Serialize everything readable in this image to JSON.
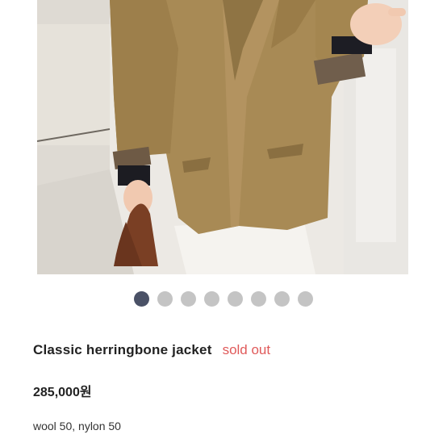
{
  "product": {
    "title": "Classic herringbone jacket",
    "status": "sold out",
    "price": "285,000원",
    "material": "wool 50, nylon 50"
  },
  "carousel": {
    "total": 8,
    "active_index": 0
  },
  "colors": {
    "sold_out": "#e05a5a",
    "dot_active": "#4a5166",
    "dot_inactive": "#c4c4c4"
  }
}
